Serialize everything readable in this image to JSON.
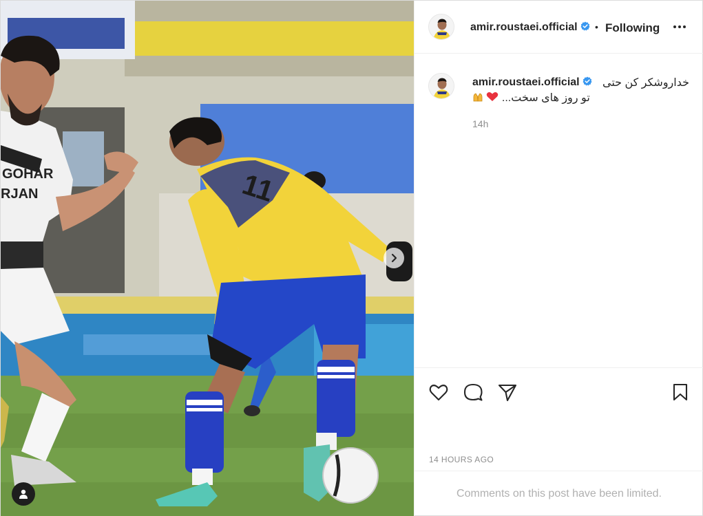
{
  "post": {
    "username": "amir.roustaei.official",
    "header": {
      "follow_state": "Following",
      "separator": "•"
    },
    "caption": {
      "line1": "خداروشکر کن حتی",
      "line2_text": "...تو روز های سخت",
      "line2_emojis": [
        "heart-emoji",
        "folded-hands-emoji"
      ],
      "time": "14h"
    },
    "timestamp": "14 HOURS AGO",
    "comments_notice": "Comments on this post have been limited."
  },
  "media": {
    "description_text": "",
    "has_next_slide": true,
    "has_tagged_users": true
  },
  "colors": {
    "verified": "#3897f0",
    "secondary_text": "#8e8e8e",
    "heart": "#e8323e",
    "jersey_yellow": "#f2d33a",
    "shorts_blue": "#2447c8"
  }
}
